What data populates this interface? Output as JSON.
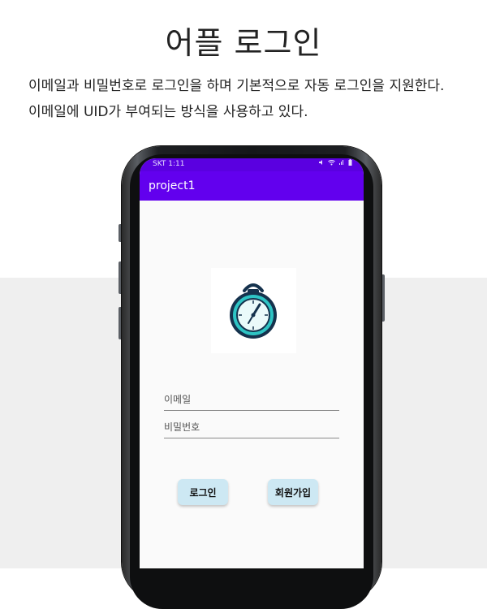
{
  "page": {
    "title": "어플 로그인",
    "description_line1": "이메일과 비밀번호로 로그인을 하며 기본적으로 자동 로그인을 지원한다.",
    "description_line2": "이메일에 UID가 부여되는 방식을 사용하고 있다."
  },
  "phone": {
    "status_bar": {
      "time": "SKT 1:11",
      "icons": [
        "mute-icon",
        "wifi-icon",
        "signal-icon",
        "battery-icon"
      ]
    },
    "app_bar": {
      "title": "project1"
    },
    "logo": {
      "icon": "stopwatch-icon"
    },
    "form": {
      "email_placeholder": "이메일",
      "email_value": "",
      "password_placeholder": "비밀번호",
      "password_value": ""
    },
    "buttons": {
      "login_label": "로그인",
      "signup_label": "회원가입"
    }
  },
  "colors": {
    "status_bar": "#5a00e0",
    "app_bar": "#6200ee",
    "button_bg": "#cde8f3",
    "logo_teal": "#2ec4c4",
    "logo_navy": "#15324d",
    "page_band": "#efefef"
  }
}
